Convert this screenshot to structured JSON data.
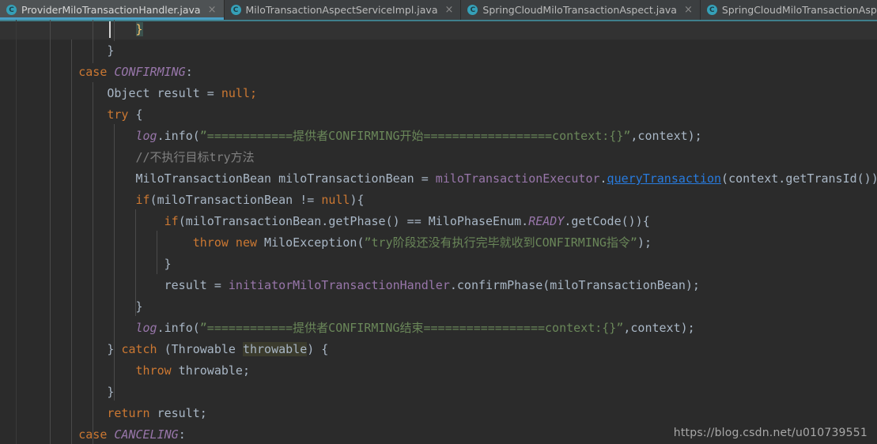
{
  "window": {
    "title": "ProviderMiloTransactionHandler.java",
    "theme": "Darcula",
    "colors": {
      "editor_background": "#2b2b2b",
      "tabbar_background": "#3c3f41",
      "active_tab_background": "#4e5254",
      "active_tab_underline": "#4a9ec4",
      "keyword": "#cc7832",
      "string": "#6a8759",
      "comment": "#808080",
      "field": "#9876aa",
      "text": "#a9b7c6",
      "link": "#287bde",
      "identifier_highlight": "#3b3b2d",
      "brace_match_highlight": "#3b514d",
      "caret_line": "#323232"
    }
  },
  "tabs": [
    {
      "label": "ProviderMiloTransactionHandler.java",
      "icon": "java-class-icon",
      "close_label": "×",
      "active": true
    },
    {
      "label": "MiloTransactionAspectServiceImpl.java",
      "icon": "java-class-icon",
      "close_label": "×",
      "active": false
    },
    {
      "label": "SpringCloudMiloTransactionAspect.java",
      "icon": "java-class-icon",
      "close_label": "×",
      "active": false
    },
    {
      "label": "SpringCloudMiloTransactionAspectHandler.java",
      "icon": "java-class-icon",
      "close_label": "×",
      "active": false
    }
  ],
  "tab_icon_letter": "C",
  "code": {
    "lines": [
      {
        "indent": 0,
        "segments": [
          {
            "t": "                }",
            "c": "brace-hl-line"
          }
        ]
      },
      {
        "indent": 0,
        "segments": [
          {
            "t": "            }",
            "c": "txt"
          }
        ]
      },
      {
        "indent": 0,
        "segments": [
          {
            "t": "        ",
            "c": "txt"
          },
          {
            "t": "case ",
            "c": "kw"
          },
          {
            "t": "CONFIRMING",
            "c": "stat"
          },
          {
            "t": ":",
            "c": "txt"
          }
        ]
      },
      {
        "indent": 0,
        "segments": [
          {
            "t": "            Object result = ",
            "c": "txt"
          },
          {
            "t": "null",
            "c": "kw"
          },
          {
            "t": ";",
            "c": "semi"
          }
        ]
      },
      {
        "indent": 0,
        "segments": [
          {
            "t": "            ",
            "c": "txt"
          },
          {
            "t": "try",
            "c": "kw"
          },
          {
            "t": " {",
            "c": "txt"
          }
        ]
      },
      {
        "indent": 0,
        "segments": [
          {
            "t": "                ",
            "c": "txt"
          },
          {
            "t": "log",
            "c": "fldi"
          },
          {
            "t": ".info(",
            "c": "txt"
          },
          {
            "t": "”============提供者CONFIRMING开始==================context:{}”",
            "c": "str"
          },
          {
            "t": ",context);",
            "c": "txt"
          }
        ]
      },
      {
        "indent": 0,
        "segments": [
          {
            "t": "                ",
            "c": "txt"
          },
          {
            "t": "//不执行目标try方法",
            "c": "cmt"
          }
        ]
      },
      {
        "indent": 0,
        "segments": [
          {
            "t": "                MiloTransactionBean miloTransactionBean = ",
            "c": "txt"
          },
          {
            "t": "miloTransactionExecutor",
            "c": "fld"
          },
          {
            "t": ".",
            "c": "txt"
          },
          {
            "t": "queryTransaction",
            "c": "lnk"
          },
          {
            "t": "(context.getTransId());",
            "c": "txt"
          }
        ]
      },
      {
        "indent": 0,
        "segments": [
          {
            "t": "                ",
            "c": "txt"
          },
          {
            "t": "if",
            "c": "kw"
          },
          {
            "t": "(miloTransactionBean != ",
            "c": "txt"
          },
          {
            "t": "null",
            "c": "kw"
          },
          {
            "t": "){",
            "c": "txt"
          }
        ]
      },
      {
        "indent": 0,
        "segments": [
          {
            "t": "                    ",
            "c": "txt"
          },
          {
            "t": "if",
            "c": "kw"
          },
          {
            "t": "(miloTransactionBean.getPhase() == MiloPhaseEnum.",
            "c": "txt"
          },
          {
            "t": "READY",
            "c": "stat"
          },
          {
            "t": ".getCode()){",
            "c": "txt"
          }
        ]
      },
      {
        "indent": 0,
        "segments": [
          {
            "t": "                        ",
            "c": "txt"
          },
          {
            "t": "throw new",
            "c": "kw"
          },
          {
            "t": " MiloException(",
            "c": "txt"
          },
          {
            "t": "”try阶段还没有执行完毕就收到CONFIRMING指令”",
            "c": "str"
          },
          {
            "t": ");",
            "c": "txt"
          }
        ]
      },
      {
        "indent": 0,
        "segments": [
          {
            "t": "                    }",
            "c": "txt"
          }
        ]
      },
      {
        "indent": 0,
        "segments": [
          {
            "t": "                    result = ",
            "c": "txt"
          },
          {
            "t": "initiatorMiloTransactionHandler",
            "c": "fld"
          },
          {
            "t": ".confirmPhase(miloTransactionBean);",
            "c": "txt"
          }
        ]
      },
      {
        "indent": 0,
        "segments": [
          {
            "t": "                }",
            "c": "txt"
          }
        ]
      },
      {
        "indent": 0,
        "segments": [
          {
            "t": "                ",
            "c": "txt"
          },
          {
            "t": "log",
            "c": "fldi"
          },
          {
            "t": ".info(",
            "c": "txt"
          },
          {
            "t": "”============提供者CONFIRMING结束=================context:{}”",
            "c": "str"
          },
          {
            "t": ",context);",
            "c": "txt"
          }
        ]
      },
      {
        "indent": 0,
        "segments": [
          {
            "t": "            } ",
            "c": "txt"
          },
          {
            "t": "catch",
            "c": "kw"
          },
          {
            "t": " (Throwable ",
            "c": "txt"
          },
          {
            "t": "throwable",
            "c": "hl"
          },
          {
            "t": ") {",
            "c": "txt"
          }
        ]
      },
      {
        "indent": 0,
        "segments": [
          {
            "t": "                ",
            "c": "txt"
          },
          {
            "t": "throw",
            "c": "kw"
          },
          {
            "t": " throwable;",
            "c": "txt"
          }
        ]
      },
      {
        "indent": 0,
        "segments": [
          {
            "t": "            }",
            "c": "txt"
          }
        ]
      },
      {
        "indent": 0,
        "segments": [
          {
            "t": "            ",
            "c": "txt"
          },
          {
            "t": "return",
            "c": "kw"
          },
          {
            "t": " result;",
            "c": "txt"
          }
        ]
      },
      {
        "indent": 0,
        "segments": [
          {
            "t": "        ",
            "c": "txt"
          },
          {
            "t": "case ",
            "c": "kw"
          },
          {
            "t": "CANCELING",
            "c": "stat"
          },
          {
            "t": ":",
            "c": "txt"
          }
        ]
      }
    ]
  },
  "watermark": {
    "text": "https://blog.csdn.net/u010739551"
  }
}
